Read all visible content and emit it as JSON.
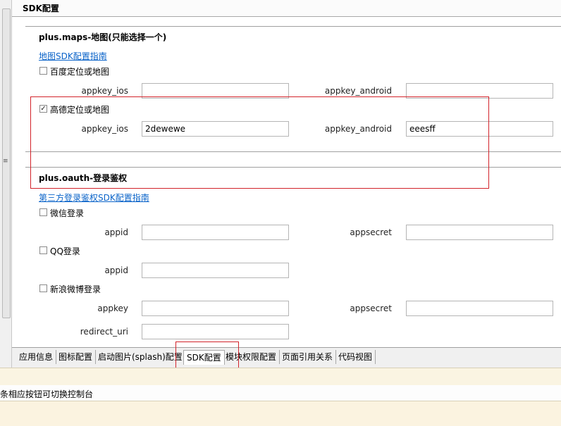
{
  "header": {
    "title": "SDK配置"
  },
  "maps": {
    "title": "plus.maps-地图(只能选择一个)",
    "guide_link": "地图SDK配置指南",
    "providers": [
      {
        "label": "百度定位或地图",
        "checked": false,
        "appkey_ios_label": "appkey_ios",
        "appkey_ios": "",
        "appkey_android_label": "appkey_android",
        "appkey_android": ""
      },
      {
        "label": "高德定位或地图",
        "checked": true,
        "appkey_ios_label": "appkey_ios",
        "appkey_ios": "2dewewe",
        "appkey_android_label": "appkey_android",
        "appkey_android": "eeesff"
      }
    ]
  },
  "oauth": {
    "title": "plus.oauth-登录鉴权",
    "guide_link": "第三方登录鉴权SDK配置指南",
    "weixin": {
      "label": "微信登录",
      "checked": false,
      "appid_label": "appid",
      "appid": "",
      "appsecret_label": "appsecret",
      "appsecret": ""
    },
    "qq": {
      "label": "QQ登录",
      "checked": false,
      "appid_label": "appid",
      "appid": ""
    },
    "sina": {
      "label": "新浪微博登录",
      "checked": false,
      "appkey_label": "appkey",
      "appkey": "",
      "appsecret_label": "appsecret",
      "appsecret": "",
      "redirect_uri_label": "redirect_uri",
      "redirect_uri": ""
    }
  },
  "tabs": [
    {
      "label": "应用信息",
      "active": false
    },
    {
      "label": "图标配置",
      "active": false
    },
    {
      "label": "启动图片(splash)配置",
      "active": false
    },
    {
      "label": "SDK配置",
      "active": true
    },
    {
      "label": "模块权限配置",
      "active": false
    },
    {
      "label": "页面引用关系",
      "active": false
    },
    {
      "label": "代码视图",
      "active": false
    }
  ],
  "status": {
    "text": "条相应按钮可切换控制台"
  },
  "colors": {
    "link": "#0a63c9",
    "highlight": "#d2232a"
  }
}
